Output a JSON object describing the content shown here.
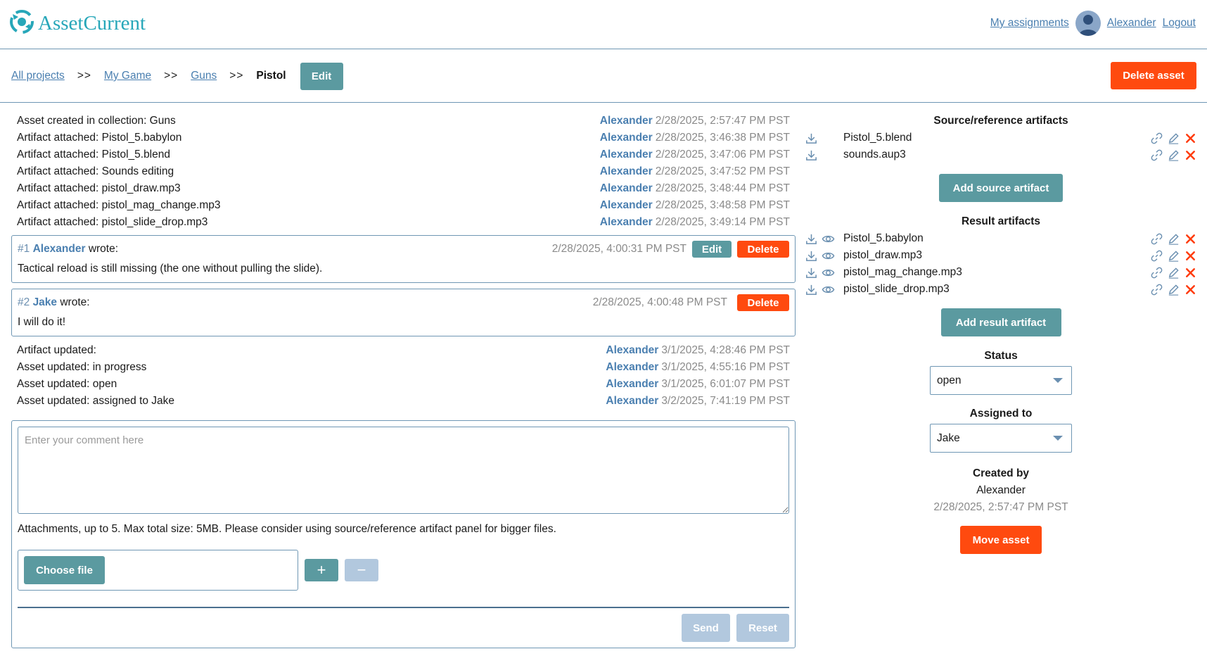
{
  "header": {
    "brand": "AssetCurrent",
    "my_assignments": "My assignments",
    "user_name": "Alexander",
    "logout": "Logout"
  },
  "breadcrumb": {
    "items": [
      "All projects",
      "My Game",
      "Guns"
    ],
    "separator": ">>",
    "current": "Pistol",
    "edit_label": "Edit",
    "delete_asset_label": "Delete asset"
  },
  "events_top": [
    {
      "text": "Asset created in collection: Guns",
      "author": "Alexander",
      "time": "2/28/2025, 2:57:47 PM PST"
    },
    {
      "text": "Artifact attached: Pistol_5.babylon",
      "author": "Alexander",
      "time": "2/28/2025, 3:46:38 PM PST"
    },
    {
      "text": "Artifact attached: Pistol_5.blend",
      "author": "Alexander",
      "time": "2/28/2025, 3:47:06 PM PST"
    },
    {
      "text": "Artifact attached: Sounds editing",
      "author": "Alexander",
      "time": "2/28/2025, 3:47:52 PM PST"
    },
    {
      "text": "Artifact attached: pistol_draw.mp3",
      "author": "Alexander",
      "time": "2/28/2025, 3:48:44 PM PST"
    },
    {
      "text": "Artifact attached: pistol_mag_change.mp3",
      "author": "Alexander",
      "time": "2/28/2025, 3:48:58 PM PST"
    },
    {
      "text": "Artifact attached: pistol_slide_drop.mp3",
      "author": "Alexander",
      "time": "2/28/2025, 3:49:14 PM PST"
    }
  ],
  "comments": [
    {
      "num": "#1",
      "author": "Alexander",
      "wrote": "wrote:",
      "time": "2/28/2025, 4:00:31 PM PST",
      "body": "Tactical reload is still missing (the one without pulling the slide).",
      "edit_label": "Edit",
      "delete_label": "Delete"
    },
    {
      "num": "#2",
      "author": "Jake",
      "wrote": "wrote:",
      "time": "2/28/2025, 4:00:48 PM PST",
      "body": "I will do it!",
      "delete_label": "Delete"
    }
  ],
  "events_bottom": [
    {
      "text": "Artifact updated:",
      "author": "Alexander",
      "time": "3/1/2025, 4:28:46 PM PST"
    },
    {
      "text": "Asset updated: in progress",
      "author": "Alexander",
      "time": "3/1/2025, 4:55:16 PM PST"
    },
    {
      "text": "Asset updated: open",
      "author": "Alexander",
      "time": "3/1/2025, 6:01:07 PM PST"
    },
    {
      "text": "Asset updated: assigned to Jake",
      "author": "Alexander",
      "time": "3/2/2025, 7:41:19 PM PST"
    }
  ],
  "comment_form": {
    "placeholder": "Enter your comment here",
    "attachments_note": "Attachments, up to 5. Max total size: 5MB. Please consider using source/reference artifact panel for bigger files.",
    "choose_file": "Choose file",
    "add": "+",
    "remove": "−",
    "send": "Send",
    "reset": "Reset"
  },
  "sidebar": {
    "source_title": "Source/reference artifacts",
    "source_artifacts": [
      "Pistol_5.blend",
      "sounds.aup3"
    ],
    "add_source": "Add source artifact",
    "result_title": "Result artifacts",
    "result_artifacts": [
      "Pistol_5.babylon",
      "pistol_draw.mp3",
      "pistol_mag_change.mp3",
      "pistol_slide_drop.mp3"
    ],
    "add_result": "Add result artifact",
    "status_label": "Status",
    "status_value": "open",
    "assigned_label": "Assigned to",
    "assigned_value": "Jake",
    "created_by_label": "Created by",
    "created_by_name": "Alexander",
    "created_by_date": "2/28/2025, 2:57:47 PM PST",
    "move_asset": "Move asset"
  },
  "colors": {
    "teal": "#5b9aa0",
    "red": "#ff4a0f",
    "link": "#4a7fb0",
    "brand": "#27a7b9"
  }
}
